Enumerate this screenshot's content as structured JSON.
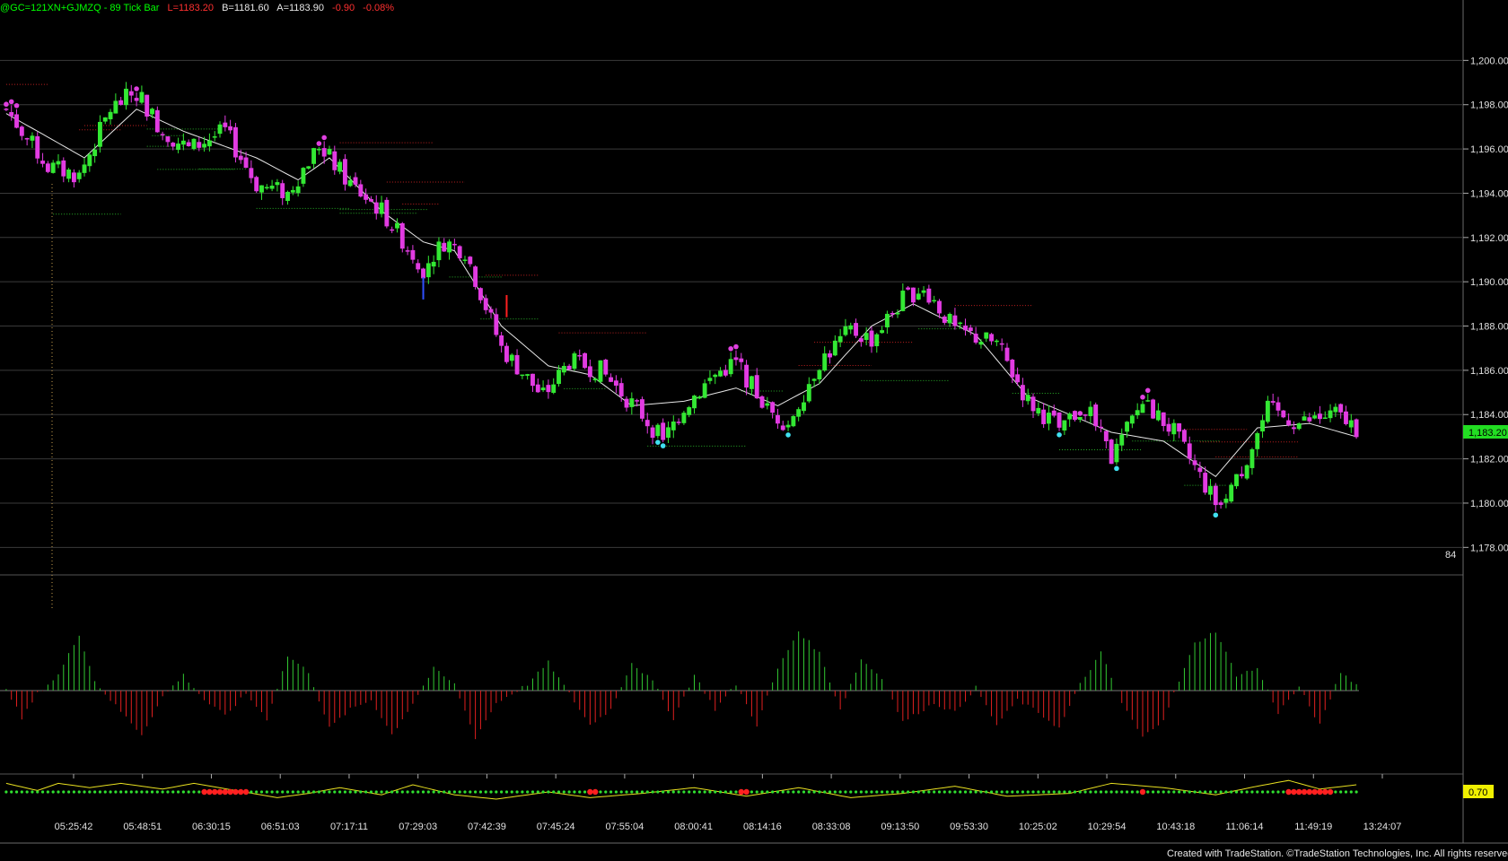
{
  "header": {
    "symbol": "@GC=121XN+GJMZQ - 89 Tick Bar",
    "last": "L=1183.20",
    "bid": "B=1181.60",
    "ask": "A=1183.90",
    "change": "-0.90",
    "change_pct": "-0.08%"
  },
  "footer": {
    "credit": "Created with TradeStation. ©TradeStation Technologies, Inc. All rights reserved."
  },
  "colors": {
    "up": "#33e833",
    "down": "#e23be2",
    "avg": "#e6e6e6",
    "pos": "#32c832",
    "neg": "#e02020",
    "grid": "#3a3a3a"
  },
  "chart_data": [
    {
      "type": "candlestick",
      "ylim": [
        1177,
        1202
      ],
      "yticks": [
        1178,
        1180,
        1182,
        1184,
        1186,
        1188,
        1190,
        1192,
        1194,
        1196,
        1198,
        1200
      ],
      "ytick_labels": [
        "1,178.00",
        "1,180.00",
        "1,182.00",
        "1,184.00",
        "1,186.00",
        "1,188.00",
        "1,190.00",
        "1,192.00",
        "1,194.00",
        "1,196.00",
        "1,198.00",
        "1,200.00"
      ],
      "last_price_label": "1,183.20",
      "last_price": 1183.2,
      "bar_count_label": "84",
      "xtick_labels": [
        "05:25:42",
        "05:48:51",
        "06:30:15",
        "06:51:03",
        "07:17:11",
        "07:29:03",
        "07:42:39",
        "07:45:24",
        "07:55:04",
        "08:00:41",
        "08:14:16",
        "08:33:08",
        "09:13:50",
        "09:53:30",
        "10:25:02",
        "10:29:54",
        "10:43:18",
        "11:06:14",
        "11:49:19",
        "13:24:07"
      ],
      "price_path": [
        [
          0,
          1197.8
        ],
        [
          8,
          1195.2
        ],
        [
          14,
          1194.8
        ],
        [
          20,
          1197.8
        ],
        [
          25,
          1198.6
        ],
        [
          30,
          1196.8
        ],
        [
          35,
          1196.0
        ],
        [
          42,
          1196.8
        ],
        [
          48,
          1194.4
        ],
        [
          54,
          1194.0
        ],
        [
          60,
          1196.2
        ],
        [
          66,
          1194.4
        ],
        [
          72,
          1193.2
        ],
        [
          80,
          1190.6
        ],
        [
          84,
          1191.8
        ],
        [
          88,
          1191.4
        ],
        [
          95,
          1187.0
        ],
        [
          103,
          1184.8
        ],
        [
          108,
          1186.4
        ],
        [
          114,
          1186.0
        ],
        [
          122,
          1184.0
        ],
        [
          126,
          1182.8
        ],
        [
          130,
          1184.4
        ],
        [
          136,
          1185.8
        ],
        [
          140,
          1186.4
        ],
        [
          146,
          1184.2
        ],
        [
          150,
          1183.6
        ],
        [
          156,
          1186.4
        ],
        [
          162,
          1187.8
        ],
        [
          166,
          1187.4
        ],
        [
          172,
          1189.2
        ],
        [
          176,
          1189.8
        ],
        [
          182,
          1187.8
        ],
        [
          190,
          1187.2
        ],
        [
          196,
          1184.6
        ],
        [
          202,
          1183.4
        ],
        [
          207,
          1184.4
        ],
        [
          212,
          1182.0
        ],
        [
          218,
          1184.6
        ],
        [
          224,
          1183.2
        ],
        [
          232,
          1180.0
        ],
        [
          236,
          1181.0
        ],
        [
          242,
          1184.2
        ],
        [
          248,
          1183.6
        ],
        [
          255,
          1184.0
        ],
        [
          259,
          1183.4
        ]
      ],
      "ma_path": [
        [
          0,
          1197.6
        ],
        [
          15,
          1195.6
        ],
        [
          25,
          1197.8
        ],
        [
          34,
          1196.8
        ],
        [
          48,
          1195.6
        ],
        [
          56,
          1194.6
        ],
        [
          62,
          1195.6
        ],
        [
          72,
          1193.2
        ],
        [
          80,
          1191.8
        ],
        [
          86,
          1191.4
        ],
        [
          95,
          1188.0
        ],
        [
          104,
          1186.2
        ],
        [
          112,
          1185.8
        ],
        [
          120,
          1184.4
        ],
        [
          130,
          1184.6
        ],
        [
          140,
          1185.2
        ],
        [
          148,
          1184.4
        ],
        [
          156,
          1185.4
        ],
        [
          166,
          1188.0
        ],
        [
          174,
          1189.0
        ],
        [
          186,
          1187.6
        ],
        [
          196,
          1184.8
        ],
        [
          206,
          1183.8
        ],
        [
          212,
          1183.2
        ],
        [
          222,
          1182.8
        ],
        [
          232,
          1181.2
        ],
        [
          240,
          1183.4
        ],
        [
          250,
          1183.6
        ],
        [
          259,
          1183.0
        ]
      ]
    },
    {
      "type": "histogram",
      "ylim": [
        -1,
        1
      ],
      "oscillator": [
        [
          0,
          0.05
        ],
        [
          3,
          -0.45
        ],
        [
          6,
          -0.05
        ],
        [
          10,
          0.25
        ],
        [
          14,
          0.9
        ],
        [
          17,
          0.15
        ],
        [
          20,
          -0.15
        ],
        [
          26,
          -0.7
        ],
        [
          30,
          -0.1
        ],
        [
          34,
          0.25
        ],
        [
          38,
          -0.15
        ],
        [
          42,
          -0.4
        ],
        [
          46,
          -0.05
        ],
        [
          50,
          -0.45
        ],
        [
          54,
          0.55
        ],
        [
          58,
          0.3
        ],
        [
          62,
          -0.6
        ],
        [
          66,
          -0.3
        ],
        [
          70,
          -0.15
        ],
        [
          74,
          -0.7
        ],
        [
          78,
          -0.2
        ],
        [
          82,
          0.35
        ],
        [
          86,
          0.1
        ],
        [
          90,
          -0.75
        ],
        [
          94,
          -0.2
        ],
        [
          100,
          0.1
        ],
        [
          104,
          0.45
        ],
        [
          108,
          -0.05
        ],
        [
          112,
          -0.55
        ],
        [
          116,
          -0.3
        ],
        [
          120,
          0.45
        ],
        [
          124,
          0.15
        ],
        [
          128,
          -0.45
        ],
        [
          132,
          0.25
        ],
        [
          136,
          -0.3
        ],
        [
          140,
          0.1
        ],
        [
          144,
          -0.55
        ],
        [
          148,
          0.35
        ],
        [
          152,
          0.95
        ],
        [
          156,
          0.6
        ],
        [
          160,
          -0.3
        ],
        [
          164,
          0.5
        ],
        [
          168,
          0.2
        ],
        [
          172,
          -0.5
        ],
        [
          178,
          -0.2
        ],
        [
          182,
          -0.35
        ],
        [
          186,
          0.05
        ],
        [
          190,
          -0.55
        ],
        [
          194,
          -0.15
        ],
        [
          198,
          -0.35
        ],
        [
          202,
          -0.6
        ],
        [
          206,
          0.1
        ],
        [
          210,
          0.6
        ],
        [
          214,
          -0.2
        ],
        [
          218,
          -0.75
        ],
        [
          222,
          -0.45
        ],
        [
          228,
          0.75
        ],
        [
          232,
          0.95
        ],
        [
          236,
          0.25
        ],
        [
          240,
          0.35
        ],
        [
          244,
          -0.35
        ],
        [
          248,
          0.05
        ],
        [
          252,
          -0.55
        ],
        [
          256,
          0.3
        ],
        [
          259,
          0.1
        ]
      ]
    },
    {
      "type": "line",
      "label": "0.70",
      "yellow_line": [
        [
          0,
          0.6
        ],
        [
          6,
          0.1
        ],
        [
          10,
          0.6
        ],
        [
          16,
          0.3
        ],
        [
          22,
          0.6
        ],
        [
          30,
          0.2
        ],
        [
          36,
          0.6
        ],
        [
          44,
          0.1
        ],
        [
          52,
          -0.4
        ],
        [
          58,
          -0.1
        ],
        [
          64,
          0.3
        ],
        [
          72,
          -0.2
        ],
        [
          78,
          0.5
        ],
        [
          86,
          -0.2
        ],
        [
          94,
          -0.5
        ],
        [
          104,
          0.0
        ],
        [
          112,
          -0.4
        ],
        [
          122,
          -0.1
        ],
        [
          132,
          0.3
        ],
        [
          142,
          -0.3
        ],
        [
          152,
          0.3
        ],
        [
          162,
          -0.4
        ],
        [
          172,
          -0.1
        ],
        [
          182,
          0.4
        ],
        [
          192,
          -0.3
        ],
        [
          204,
          -0.1
        ],
        [
          212,
          0.6
        ],
        [
          222,
          0.3
        ],
        [
          232,
          -0.2
        ],
        [
          240,
          0.4
        ],
        [
          246,
          0.8
        ],
        [
          252,
          0.2
        ],
        [
          259,
          0.5
        ]
      ],
      "red_marks": [
        [
          38,
          46
        ],
        [
          112,
          113
        ],
        [
          141,
          142
        ],
        [
          218,
          218
        ],
        [
          246,
          254
        ]
      ]
    }
  ]
}
